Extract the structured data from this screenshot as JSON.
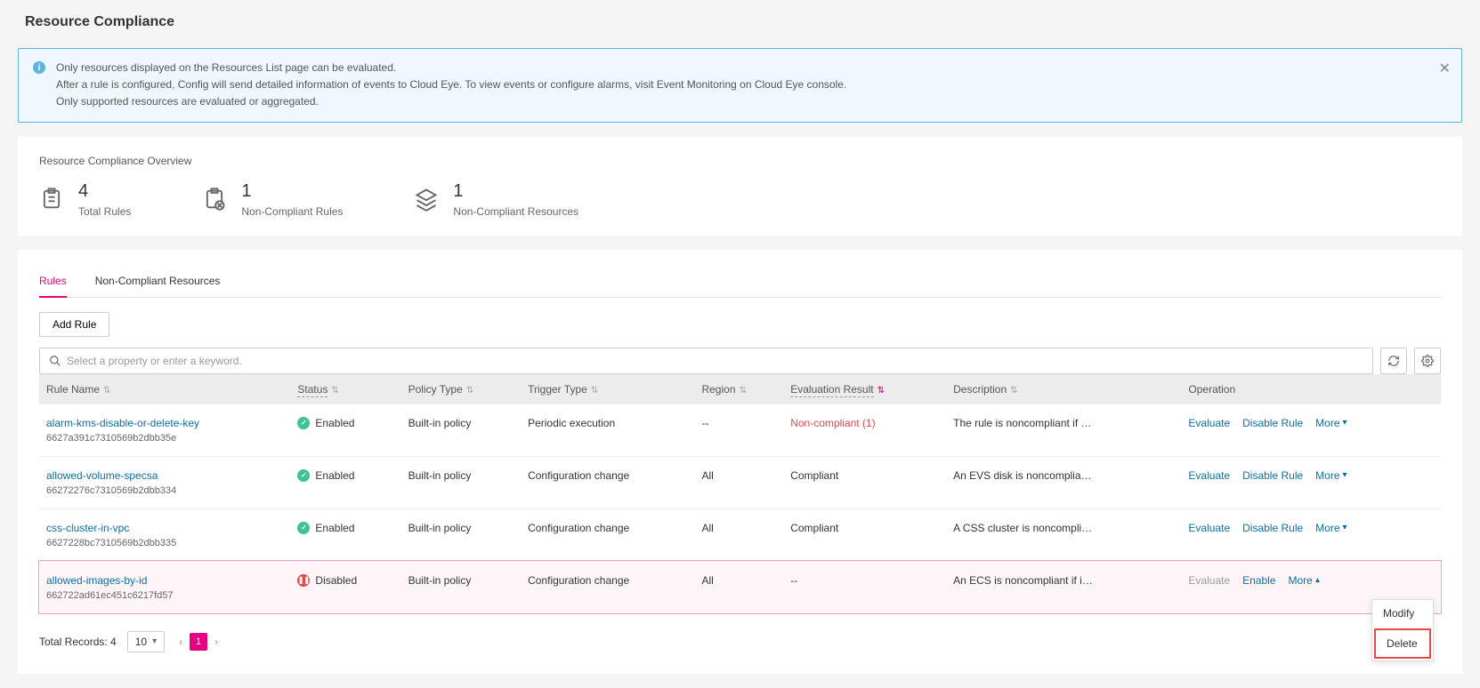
{
  "pageTitle": "Resource Compliance",
  "infoBanner": {
    "line1": "Only resources displayed on the Resources List page can be evaluated.",
    "line2": "After a rule is configured, Config will send detailed information of events to Cloud Eye. To view events or configure alarms, visit Event Monitoring on Cloud Eye console.",
    "line3": "Only supported resources are evaluated or aggregated."
  },
  "overview": {
    "title": "Resource Compliance Overview",
    "stats": [
      {
        "value": "4",
        "label": "Total Rules"
      },
      {
        "value": "1",
        "label": "Non-Compliant Rules"
      },
      {
        "value": "1",
        "label": "Non-Compliant Resources"
      }
    ]
  },
  "tabs": [
    {
      "label": "Rules",
      "active": true
    },
    {
      "label": "Non-Compliant Resources",
      "active": false
    }
  ],
  "addRuleLabel": "Add Rule",
  "searchPlaceholder": "Select a property or enter a keyword.",
  "columns": {
    "ruleName": "Rule Name",
    "status": "Status",
    "policyType": "Policy Type",
    "triggerType": "Trigger Type",
    "region": "Region",
    "evalResult": "Evaluation Result",
    "description": "Description",
    "operation": "Operation"
  },
  "rows": [
    {
      "name": "alarm-kms-disable-or-delete-key",
      "id": "6627a391c7310569b2dbb35e",
      "status": "Enabled",
      "statusKind": "enabled",
      "policyType": "Built-in policy",
      "triggerType": "Periodic execution",
      "region": "--",
      "evalResult": "Non-compliant (1)",
      "evalKind": "noncompliant",
      "description": "The rule is noncompliant if an ...",
      "ops": {
        "evaluate": "Evaluate",
        "second": "Disable Rule",
        "more": "More",
        "evaluateDisabled": false,
        "moreOpen": false
      }
    },
    {
      "name": "allowed-volume-specsa",
      "id": "66272276c7310569b2dbb334",
      "status": "Enabled",
      "statusKind": "enabled",
      "policyType": "Built-in policy",
      "triggerType": "Configuration change",
      "region": "All",
      "evalResult": "Compliant",
      "evalKind": "compliant",
      "description": "An EVS disk is noncompliant i...",
      "ops": {
        "evaluate": "Evaluate",
        "second": "Disable Rule",
        "more": "More",
        "evaluateDisabled": false,
        "moreOpen": false
      }
    },
    {
      "name": "css-cluster-in-vpc",
      "id": "6627228bc7310569b2dbb335",
      "status": "Enabled",
      "statusKind": "enabled",
      "policyType": "Built-in policy",
      "triggerType": "Configuration change",
      "region": "All",
      "evalResult": "Compliant",
      "evalKind": "compliant",
      "description": "A CSS cluster is noncompliant...",
      "ops": {
        "evaluate": "Evaluate",
        "second": "Disable Rule",
        "more": "More",
        "evaluateDisabled": false,
        "moreOpen": false
      }
    },
    {
      "name": "allowed-images-by-id",
      "id": "662722ad61ec451c6217fd57",
      "status": "Disabled",
      "statusKind": "disabled",
      "policyType": "Built-in policy",
      "triggerType": "Configuration change",
      "region": "All",
      "evalResult": "--",
      "evalKind": "none",
      "description": "An ECS is noncompliant if its i...",
      "ops": {
        "evaluate": "Evaluate",
        "second": "Enable",
        "more": "More",
        "evaluateDisabled": true,
        "moreOpen": true
      }
    }
  ],
  "moreMenu": {
    "modify": "Modify",
    "delete": "Delete"
  },
  "pagination": {
    "totalLabel": "Total Records: 4",
    "pageSize": "10",
    "current": "1"
  }
}
